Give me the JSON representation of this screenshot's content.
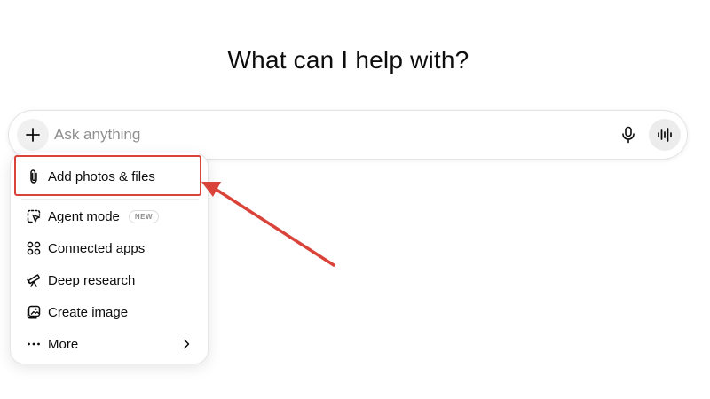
{
  "page": {
    "headline": "What can I help with?"
  },
  "composer": {
    "placeholder": "Ask anything",
    "value": "",
    "plus_icon": "plus-icon",
    "mic_icon": "microphone-icon",
    "voice_icon": "voice-waveform-icon"
  },
  "menu": {
    "items": [
      {
        "label": "Add photos & files",
        "icon": "paperclip-icon"
      },
      {
        "label": "Agent mode",
        "icon": "agent-cursor-icon",
        "badge": "NEW"
      },
      {
        "label": "Connected apps",
        "icon": "connected-apps-icon"
      },
      {
        "label": "Deep research",
        "icon": "telescope-icon"
      },
      {
        "label": "Create image",
        "icon": "image-create-icon"
      },
      {
        "label": "More",
        "icon": "more-dots-icon",
        "trailing_icon": "chevron-right-icon"
      }
    ]
  },
  "annotation": {
    "highlight_color": "#d9433a",
    "arrow_color": "#d9433a"
  }
}
